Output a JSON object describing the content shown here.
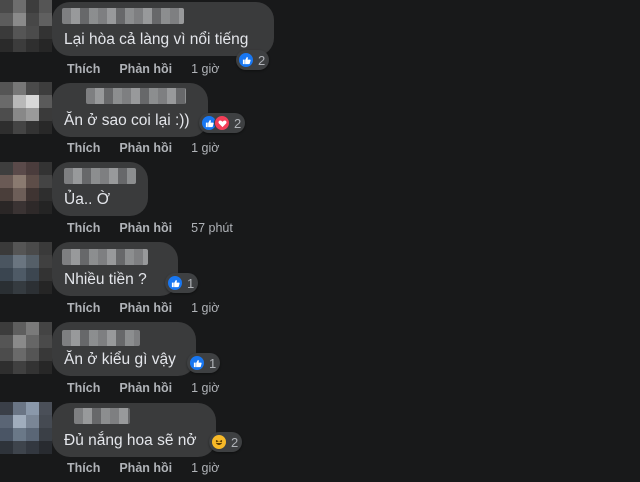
{
  "comments": [
    {
      "text": "Lại hòa cả làng vì nổi tiếng",
      "reaction_count": "2",
      "like_label": "Thích",
      "reply_label": "Phản hồi",
      "time": "1 giờ"
    },
    {
      "text": "Ăn ở sao coi lại :))",
      "reaction_count": "2",
      "like_label": "Thích",
      "reply_label": "Phản hồi",
      "time": "1 giờ"
    },
    {
      "text": "Ủa.. Ờ",
      "like_label": "Thích",
      "reply_label": "Phản hồi",
      "time": "57 phút"
    },
    {
      "text": "Nhiều tiền ?",
      "reaction_count": "1",
      "like_label": "Thích",
      "reply_label": "Phản hồi",
      "time": "1 giờ"
    },
    {
      "text": "Ăn ở kiểu gì vậy",
      "reaction_count": "1",
      "like_label": "Thích",
      "reply_label": "Phản hồi",
      "time": "1 giờ"
    },
    {
      "text": "Đủ nắng hoa sẽ nở",
      "reaction_count": "2",
      "like_label": "Thích",
      "reply_label": "Phản hồi",
      "time": "1 giờ"
    }
  ],
  "reaction_icons": {
    "c0": [
      "like-icon"
    ],
    "c1": [
      "like-icon",
      "love-icon"
    ],
    "c3": [
      "like-icon"
    ],
    "c4": [
      "like-icon"
    ],
    "c5": [
      "haha-icon"
    ]
  },
  "colors": {
    "background": "#18191a",
    "bubble": "#3a3b3c",
    "text": "#e4e6eb",
    "secondary_text": "#b0b3b8",
    "like_blue": "#1877f2",
    "love_red": "#f33e58",
    "haha_yellow": "#f7b928"
  }
}
